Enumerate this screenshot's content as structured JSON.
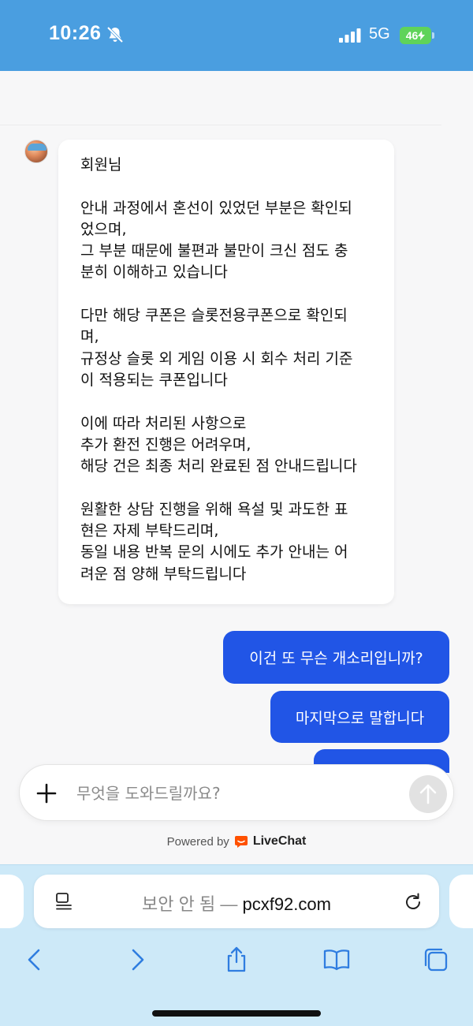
{
  "status_bar": {
    "time": "10:26",
    "network": "5G",
    "battery": "46"
  },
  "chat": {
    "agent_message_lines": [
      "회원님",
      "",
      "안내 과정에서 혼선이 있었던 부분은 확인되",
      "었으며,",
      "그 부분 때문에 불편과 불만이 크신 점도 충",
      "분히 이해하고 있습니다",
      "",
      "다만 해당 쿠폰은 슬롯전용쿠폰으로 확인되",
      "며,",
      "규정상 슬롯 외 게임 이용 시 회수 처리 기준",
      "이 적용되는 쿠폰입니다",
      "",
      "이에 따라 처리된 사항으로",
      "추가 환전 진행은 어려우며,",
      "해당 건은 최종 처리 완료된 점 안내드립니다",
      "",
      "원활한 상담 진행을 위해 욕설 및 과도한 표",
      "현은 자제 부탁드리며,",
      "동일 내용 반복 문의 시에도 추가 안내는 어",
      "려운 점 양해 부탁드립니다"
    ],
    "user_messages": [
      "이건 또 무슨 개소리입니까?",
      "마지막으로 말합니다",
      ""
    ]
  },
  "composer": {
    "placeholder": "무엇을 도와드릴까요?"
  },
  "footer": {
    "powered_by": "Powered by",
    "brand": "LiveChat"
  },
  "browser": {
    "insecure_label": "보안 안 됨 —",
    "domain": "pcxf92.com"
  },
  "colors": {
    "status_bar": "#4a9ee0",
    "user_bubble": "#2155e6",
    "browser_bar": "#cde9f8",
    "livechat_brand": "#ff5100"
  }
}
